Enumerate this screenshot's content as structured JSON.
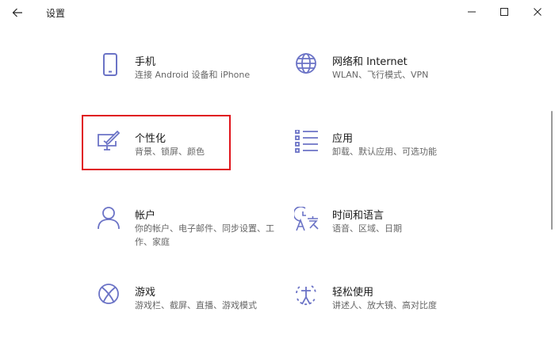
{
  "window": {
    "title": "设置",
    "back_icon": "arrow-left-icon",
    "minimize_icon": "minimize-icon",
    "maximize_icon": "maximize-icon",
    "close_icon": "close-icon"
  },
  "accent_color": "#6b73c6",
  "highlight_color": "#e0141c",
  "categories": [
    {
      "name": "手机",
      "desc": "连接 Android 设备和 iPhone",
      "icon": "phone-icon"
    },
    {
      "name": "网络和 Internet",
      "desc": "WLAN、飞行模式、VPN",
      "icon": "globe-icon"
    },
    {
      "name": "个性化",
      "desc": "背景、锁屏、颜色",
      "icon": "personalization-icon"
    },
    {
      "name": "应用",
      "desc": "卸载、默认应用、可选功能",
      "icon": "apps-list-icon"
    },
    {
      "name": "帐户",
      "desc": "你的帐户、电子邮件、同步设置、工作、家庭",
      "icon": "person-icon"
    },
    {
      "name": "时间和语言",
      "desc": "语音、区域、日期",
      "icon": "time-language-icon"
    },
    {
      "name": "游戏",
      "desc": "游戏栏、截屏、直播、游戏模式",
      "icon": "xbox-icon"
    },
    {
      "name": "轻松使用",
      "desc": "讲述人、放大镜、高对比度",
      "icon": "ease-of-access-icon"
    }
  ]
}
